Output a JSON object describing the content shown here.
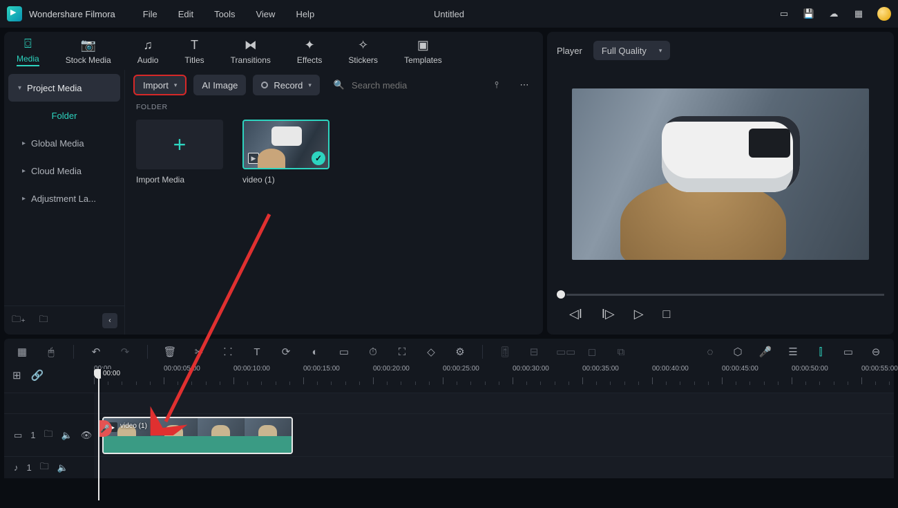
{
  "app": {
    "title": "Wondershare Filmora",
    "doc": "Untitled"
  },
  "menu": [
    "File",
    "Edit",
    "Tools",
    "View",
    "Help"
  ],
  "tabs": [
    {
      "label": "Media",
      "active": true
    },
    {
      "label": "Stock Media"
    },
    {
      "label": "Audio"
    },
    {
      "label": "Titles"
    },
    {
      "label": "Transitions"
    },
    {
      "label": "Effects"
    },
    {
      "label": "Stickers"
    },
    {
      "label": "Templates"
    }
  ],
  "sidebar": {
    "header": "Project Media",
    "folder": "Folder",
    "items": [
      "Global Media",
      "Cloud Media",
      "Adjustment La..."
    ]
  },
  "toolbar": {
    "import": "Import",
    "ai": "AI Image",
    "record": "Record",
    "searchPlaceholder": "Search media"
  },
  "folderLabel": "FOLDER",
  "media": {
    "importLabel": "Import Media",
    "video1": "video (1)"
  },
  "preview": {
    "player": "Player",
    "quality": "Full Quality"
  },
  "ruler": [
    "00:00",
    "00:00:05:00",
    "00:00:10:00",
    "00:00:15:00",
    "00:00:20:00",
    "00:00:25:00",
    "00:00:30:00",
    "00:00:35:00",
    "00:00:40:00",
    "00:00:45:00",
    "00:00:50:00",
    "00:00:55:00"
  ],
  "track": {
    "video": "1",
    "audio": "1"
  },
  "clip": {
    "label": "video (1)"
  }
}
